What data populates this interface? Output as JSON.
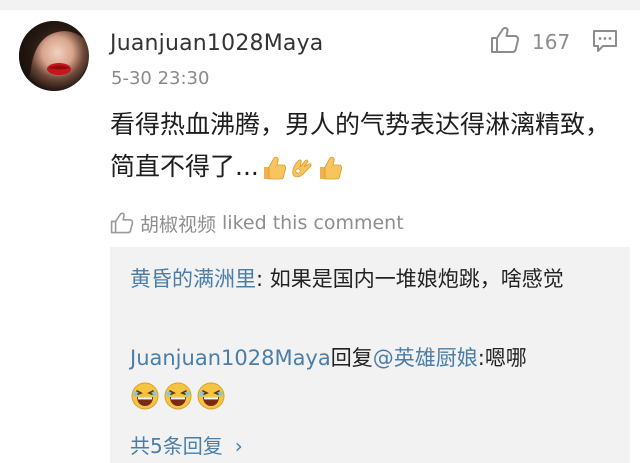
{
  "comment": {
    "username": "Juanjuan1028Maya",
    "time": "5-30 23:30",
    "like_count": "167",
    "text": "看得热血沸腾，男人的气势表达得淋漓精致，简直不得了...",
    "liked_by": "胡椒视频",
    "liked_text": "liked this comment"
  },
  "replies": [
    {
      "author": "黄昏的满洲里",
      "separator": ": ",
      "text": "如果是国内一堆娘炮跳，啥感觉"
    },
    {
      "author": "Juanjuan1028Maya",
      "action": "回复",
      "mention": "@英雄厨娘",
      "separator": ":",
      "text": "嗯哪"
    }
  ],
  "more_replies": "共5条回复",
  "icons": {
    "like": "thumbs-up-outline-icon",
    "reply": "comment-bubble-icon",
    "content_emojis": [
      "thumbs-up-emoji",
      "ok-hand-emoji",
      "thumbs-up-emoji"
    ],
    "reply_emojis": [
      "laughing-face-emoji",
      "laughing-face-emoji",
      "laughing-face-emoji"
    ]
  },
  "colors": {
    "link": "#4a7ea8",
    "meta": "#8a8a8a",
    "reply_bg": "#f2f2f2"
  }
}
